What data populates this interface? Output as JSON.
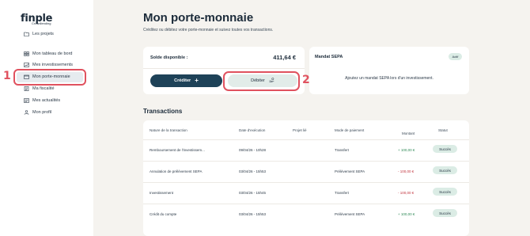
{
  "logo": {
    "main": "finple",
    "sub": "Crowdlending"
  },
  "sidebar": {
    "items": [
      {
        "label": "Les projets",
        "icon": "folder-icon"
      },
      {
        "label": "Mon tableau de bord",
        "icon": "dashboard-icon"
      },
      {
        "label": "Mes investissements",
        "icon": "chart-icon"
      },
      {
        "label": "Mon porte-monnaie",
        "icon": "wallet-icon",
        "active": true
      },
      {
        "label": "Ma fiscalité",
        "icon": "document-icon"
      },
      {
        "label": "Mes actualités",
        "icon": "news-icon"
      },
      {
        "label": "Mon profil",
        "icon": "user-icon"
      }
    ]
  },
  "markers": {
    "one": "1",
    "two": "2"
  },
  "page": {
    "title": "Mon porte-monnaie",
    "subtitle": "Créditez ou débitez votre porte-monnaie et suivez toutes vos transactions."
  },
  "solde": {
    "label": "Solde disponible :",
    "value": "411,64 €",
    "credit_label": "Créditer",
    "debit_label": "Débiter"
  },
  "mandat": {
    "title": "Mandat SEPA",
    "badge": "Actif",
    "text": "Ajoutez un mandat SEPA lors d'un investissement."
  },
  "transactions": {
    "title": "Transactions",
    "headers": {
      "nature": "Nature de la transaction",
      "date": "Date d'exécution",
      "projet": "Projet lié",
      "mode": "Mode de paiement",
      "montant": "Montant",
      "statut": "Statut"
    },
    "rows": [
      {
        "nature": "Remboursement de l'investissem...",
        "date": "09/04/26 - 10h28",
        "projet": "",
        "mode": "Transfert",
        "montant": "+ 100,00 €",
        "sign": "pos",
        "statut": "Succès"
      },
      {
        "nature": "Annulation de prélèvement SEPA",
        "date": "03/04/26 - 15h53",
        "projet": "",
        "mode": "Prélèvement SEPA",
        "montant": "- 100,00 €",
        "sign": "neg",
        "statut": "Succès"
      },
      {
        "nature": "Investissement",
        "date": "03/04/26 - 15h45",
        "projet": "",
        "mode": "Transfert",
        "montant": "- 100,00 €",
        "sign": "neg",
        "statut": "Succès"
      },
      {
        "nature": "Crédit du compte",
        "date": "03/04/26 - 15h53",
        "projet": "",
        "mode": "Prélèvement SEPA",
        "montant": "+ 100,00 €",
        "sign": "pos",
        "statut": "Succès"
      }
    ]
  },
  "colors": {
    "accent": "#1e4258",
    "highlight": "#e0525f",
    "positive": "#2f8a57",
    "negative": "#c2353f"
  }
}
